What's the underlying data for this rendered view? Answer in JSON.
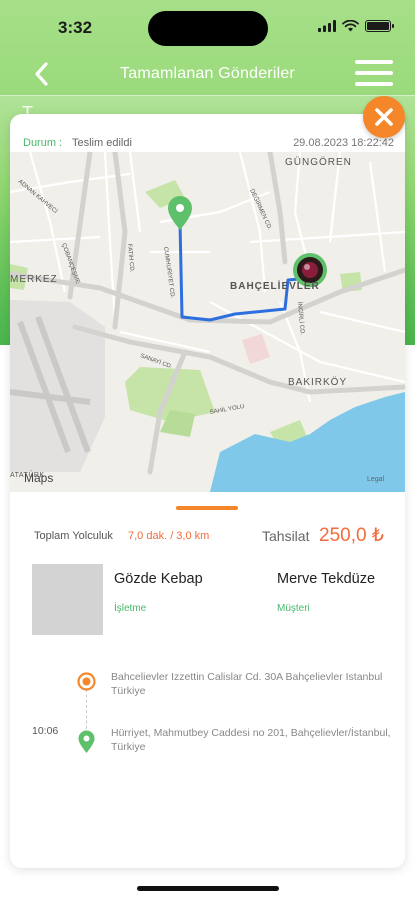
{
  "status_bar": {
    "time": "3:32"
  },
  "nav": {
    "title": "Tamamlanan Gönderiler",
    "partial_heading": "T.................."
  },
  "card": {
    "status_label": "Durum :",
    "status_value": "Teslim edildi",
    "date": "29.08.2023 18:22:42"
  },
  "map": {
    "attribution": "Maps",
    "legal": "Legal",
    "labels": {
      "gungoren": "GÜNGÖREN",
      "bahcelievler": "BAHÇELİEVLER",
      "bakirkoy": "BAKIRKÖY",
      "merkez": "MERKEZ",
      "ataturk": "ATATÜRK",
      "street_cumhuriyet": "CUMHURİYET CD.",
      "street_fatih": "FATİH CD.",
      "street_vezir": "ÇOBANÇEŞME",
      "street_degirmen": "DEĞİRMEN CD.",
      "street_incirli": "İNCİRLİ CD.",
      "street_sahil": "SAHİL YOLU",
      "street_sanayi": "SANAYİ CD.",
      "street_adnan": "ADNAN KAHVECİ"
    }
  },
  "stats": {
    "trip_label": "Toplam Yolculuk",
    "trip_value": "7,0 dak. / 3,0 km",
    "collect_label": "Tahsilat",
    "collect_value": "250,0 ₺"
  },
  "business": {
    "name": "Gözde Kebap",
    "role": "İşletme"
  },
  "customer": {
    "name": "Merve Tekdüze",
    "role": "Müşteri"
  },
  "timeline": {
    "origin_address": "Bahcelievler Izzettin Calislar Cd. 30A Bahçelievler Istanbul Türkiye",
    "dest_time": "10:06",
    "dest_address": "Hürriyet, Mahmutbey Caddesi no 201, Bahçelievler/İstanbul, Türkiye"
  },
  "colors": {
    "brand_green": "#8fd66f",
    "accent_orange": "#f5862a",
    "price_orange": "#f26b3a",
    "label_green": "#49b86a"
  },
  "icons": {
    "back": "chevron-left-icon",
    "menu": "hamburger-menu-icon",
    "close": "close-icon",
    "origin": "origin-circle-icon",
    "destination": "map-pin-icon"
  }
}
